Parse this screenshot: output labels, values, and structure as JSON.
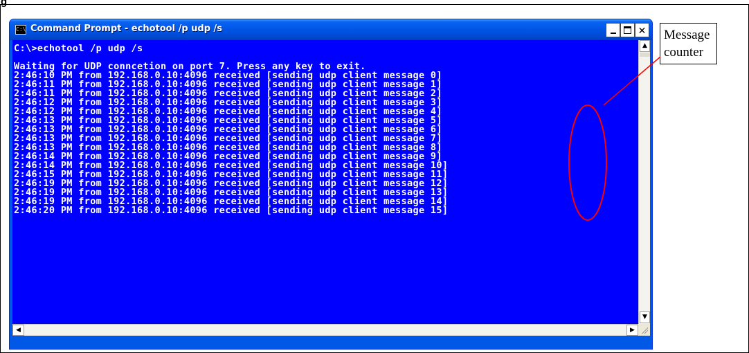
{
  "window": {
    "title": "Command Prompt - echotool /p udp /s",
    "icon": "console-icon",
    "controls": {
      "minimize": "minimize-icon",
      "maximize": "maximize-icon",
      "close": "✕"
    }
  },
  "console": {
    "command_line": "C:\\>echotool /p udp /s",
    "waiting_line": "Waiting for UDP conncetion on port 7. Press any key to exit.",
    "log_lines": [
      "2:46:10 PM from 192.168.0.10:4096 received [sending udp client message 0]",
      "2:46:11 PM from 192.168.0.10:4096 received [sending udp client message 1]",
      "2:46:11 PM from 192.168.0.10:4096 received [sending udp client message 2]",
      "2:46:12 PM from 192.168.0.10:4096 received [sending udp client message 3]",
      "2:46:12 PM from 192.168.0.10:4096 received [sending udp client message 4]",
      "2:46:13 PM from 192.168.0.10:4096 received [sending udp client message 5]",
      "2:46:13 PM from 192.168.0.10:4096 received [sending udp client message 6]",
      "2:46:13 PM from 192.168.0.10:4096 received [sending udp client message 7]",
      "2:46:13 PM from 192.168.0.10:4096 received [sending udp client message 8]",
      "2:46:14 PM from 192.168.0.10:4096 received [sending udp client message 9]",
      "2:46:14 PM from 192.168.0.10:4096 received [sending udp client message 10]",
      "2:46:15 PM from 192.168.0.10:4096 received [sending udp client message 11]",
      "2:46:19 PM from 192.168.0.10:4096 received [sending udp client message 12]",
      "2:46:19 PM from 192.168.0.10:4096 received [sending udp client message 13]",
      "2:46:19 PM from 192.168.0.10:4096 received [sending udp client message 14]",
      "2:46:20 PM from 192.168.0.10:4096 received [sending udp client message 15]"
    ]
  },
  "scrollbars": {
    "up_arrow": "▲",
    "down_arrow": "▼",
    "left_arrow": "◀",
    "right_arrow": "▶"
  },
  "annotation": {
    "text": "Message\ncounter",
    "color": "#ff0000"
  },
  "colors": {
    "console_background": "#0000ff",
    "console_text": "#ffffff",
    "cursor": "#e3c800",
    "annotation": "#ff0000"
  }
}
